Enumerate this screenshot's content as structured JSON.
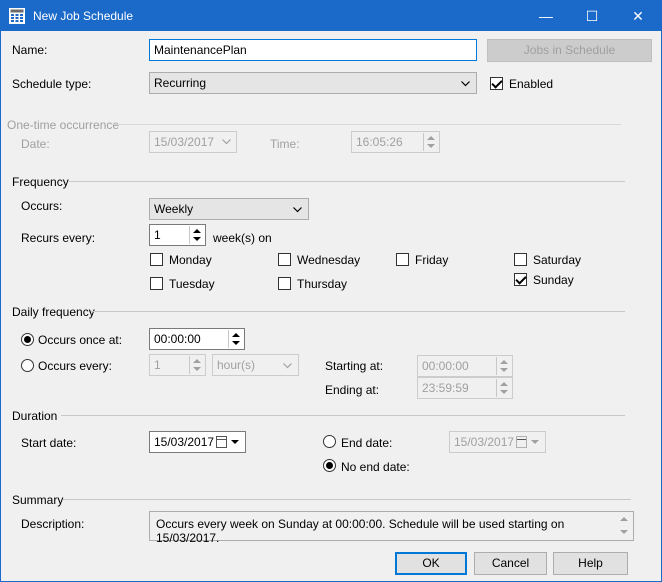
{
  "window": {
    "title": "New Job Schedule",
    "minimize_glyph": "—",
    "maximize_glyph": "☐",
    "close_glyph": "✕",
    "title_icon": "calendar-grid-icon"
  },
  "general": {
    "name_label": "Name:",
    "name_value": "MaintenancePlan",
    "jobs_button": "Jobs in Schedule",
    "schedule_type_label": "Schedule type:",
    "schedule_type_value": "Recurring",
    "enabled_label": "Enabled",
    "enabled_checked": true
  },
  "one_time": {
    "section": "One-time occurrence",
    "date_label": "Date:",
    "date_value": "15/03/2017",
    "time_label": "Time:",
    "time_value": "16:05:26"
  },
  "frequency": {
    "section": "Frequency",
    "occurs_label": "Occurs:",
    "occurs_value": "Weekly",
    "recurs_label": "Recurs every:",
    "recurs_value": "1",
    "recurs_unit": "week(s) on",
    "days": [
      {
        "label": "Monday",
        "checked": false
      },
      {
        "label": "Tuesday",
        "checked": false
      },
      {
        "label": "Wednesday",
        "checked": false
      },
      {
        "label": "Thursday",
        "checked": false
      },
      {
        "label": "Friday",
        "checked": false
      },
      {
        "label": "Saturday",
        "checked": false
      },
      {
        "label": "Sunday",
        "checked": true
      }
    ]
  },
  "daily": {
    "section": "Daily frequency",
    "once_label": "Occurs once at:",
    "once_value": "00:00:00",
    "every_label": "Occurs every:",
    "every_value": "1",
    "every_unit": "hour(s)",
    "starting_label": "Starting at:",
    "starting_value": "00:00:00",
    "ending_label": "Ending at:",
    "ending_value": "23:59:59"
  },
  "duration": {
    "section": "Duration",
    "start_label": "Start date:",
    "start_value": "15/03/2017",
    "end_label": "End date:",
    "end_value": "15/03/2017",
    "no_end_label": "No end date:"
  },
  "summary": {
    "section": "Summary",
    "description_label": "Description:",
    "description_value": "Occurs every week on Sunday at 00:00:00. Schedule will be used starting on 15/03/2017."
  },
  "buttons": {
    "ok": "OK",
    "cancel": "Cancel",
    "help": "Help"
  },
  "colors": {
    "titlebar": "#1b6ac9",
    "dialog_bg": "#f0f0f0",
    "focus_border": "#0078d7"
  }
}
